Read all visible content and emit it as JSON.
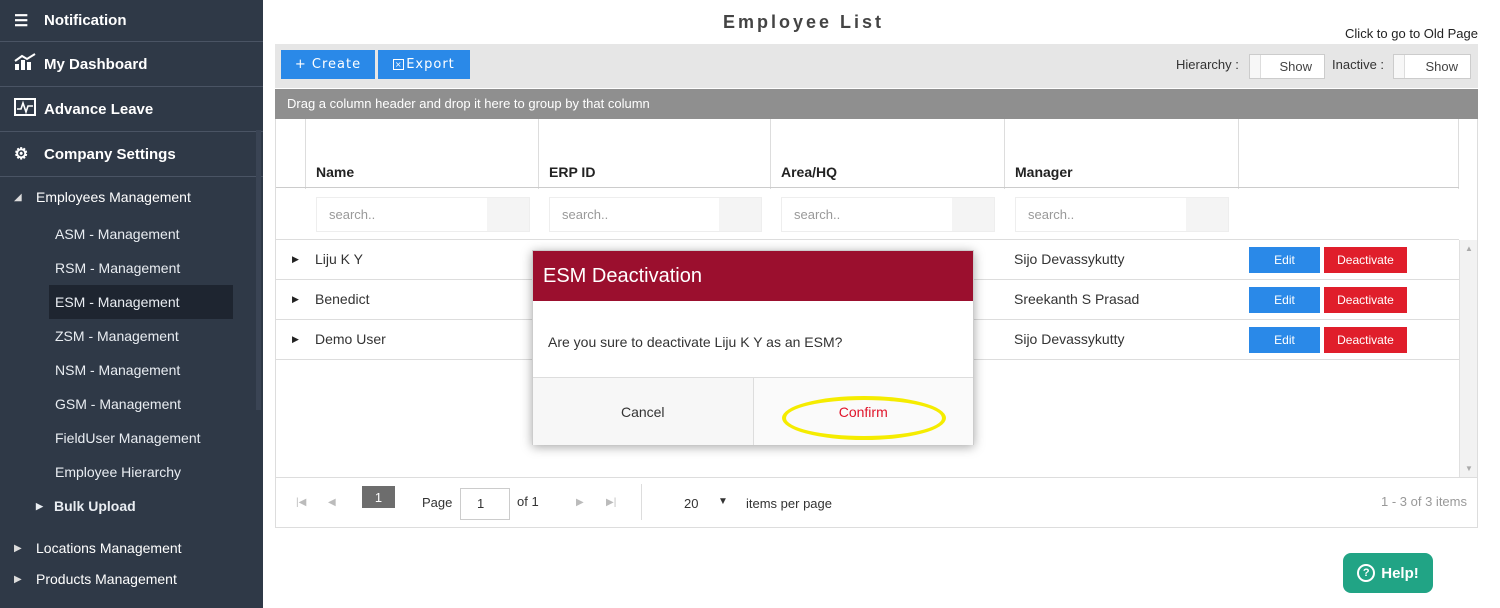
{
  "sidebar": {
    "top_items": [
      {
        "label": "Notification",
        "icon": "notification-list-icon"
      },
      {
        "label": "My Dashboard",
        "icon": "dashboard-chart-icon"
      },
      {
        "label": "Advance Leave",
        "icon": "leave-pulse-icon"
      },
      {
        "label": "Company Settings",
        "icon": "gears-icon"
      }
    ],
    "group_label": "Employees Management",
    "sub_items": [
      "ASM - Management",
      "RSM - Management",
      "ESM - Management",
      "ZSM - Management",
      "NSM - Management",
      "GSM - Management",
      "FieldUser Management",
      "Employee Hierarchy"
    ],
    "bulk_upload": "Bulk Upload",
    "locations": "Locations Management",
    "products": "Products Management"
  },
  "header": {
    "title": "Employee List",
    "old_page_link": "Click to go to Old Page"
  },
  "toolbar": {
    "create_label": "+ Create",
    "export_label": "Export",
    "hierarchy_label": "Hierarchy :",
    "hierarchy_value": "Show",
    "inactive_label": "Inactive :",
    "inactive_value": "Show"
  },
  "grid": {
    "group_hint": "Drag a column header and drop it here to group by that column",
    "columns": [
      "Name",
      "ERP ID",
      "Area/HQ",
      "Manager"
    ],
    "search_placeholder": "search..",
    "rows": [
      {
        "name": "Liju K Y",
        "manager": "Sijo Devassykutty"
      },
      {
        "name": "Benedict",
        "manager": "Sreekanth S Prasad"
      },
      {
        "name": "Demo User",
        "manager": "Sijo Devassykutty"
      }
    ],
    "edit_label": "Edit",
    "deactivate_label": "Deactivate"
  },
  "pager": {
    "current_page": "1",
    "page_label": "Page",
    "page_input": "1",
    "of_label": "of 1",
    "page_size": "20",
    "items_per_page": "items per page",
    "info": "1 - 3 of 3 items"
  },
  "modal": {
    "title": "ESM Deactivation",
    "message": "Are you sure to deactivate Liju K Y as an ESM?",
    "cancel": "Cancel",
    "confirm": "Confirm"
  },
  "help": {
    "label": "Help!"
  },
  "colors": {
    "sidebar_bg": "#2f3947",
    "modal_header": "#9b0f2e",
    "primary_blue": "#2a89e8",
    "danger_red": "#e01e2b",
    "help_green": "#21a485",
    "highlight_yellow": "#f5ec00"
  }
}
